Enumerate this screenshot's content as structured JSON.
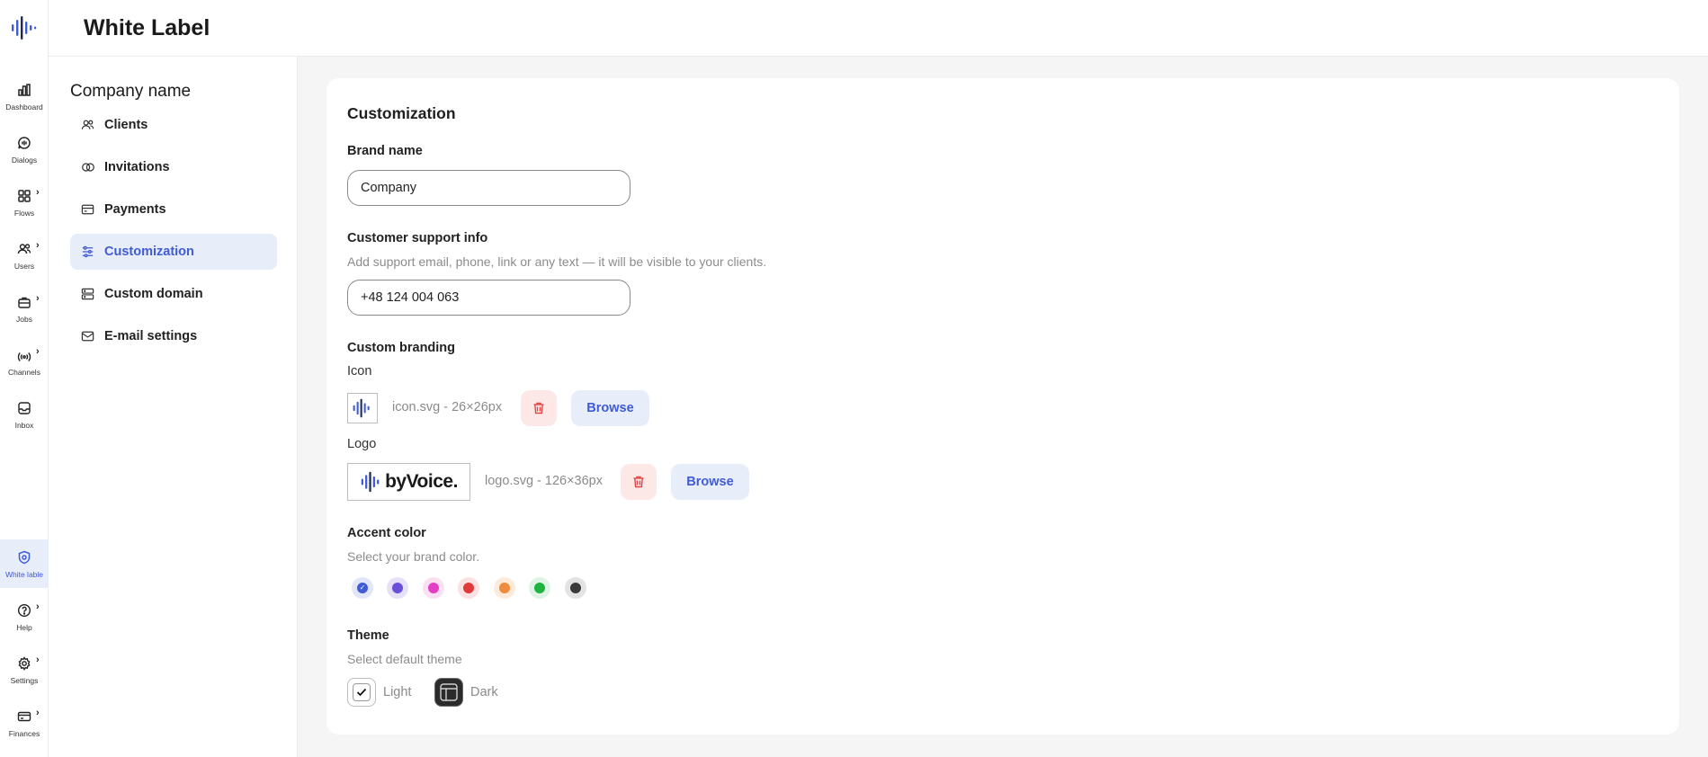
{
  "app": {
    "accent": "#3f5bd5"
  },
  "header": {
    "title": "White Label"
  },
  "rail": {
    "items": [
      {
        "label": "Dashboard",
        "icon": "bar-chart-icon",
        "has_submenu": false
      },
      {
        "label": "Dialogs",
        "icon": "chat-bubble-icon",
        "has_submenu": false
      },
      {
        "label": "Flows",
        "icon": "grid-icon",
        "has_submenu": true
      },
      {
        "label": "Users",
        "icon": "users-icon",
        "has_submenu": true
      },
      {
        "label": "Jobs",
        "icon": "briefcase-icon",
        "has_submenu": true
      },
      {
        "label": "Channels",
        "icon": "broadcast-icon",
        "has_submenu": true
      },
      {
        "label": "Inbox",
        "icon": "inbox-icon",
        "has_submenu": false
      },
      {
        "label": "White lable",
        "icon": "shield-icon",
        "has_submenu": false,
        "active": true
      },
      {
        "label": "Help",
        "icon": "help-icon",
        "has_submenu": true
      },
      {
        "label": "Settings",
        "icon": "gear-icon",
        "has_submenu": true
      },
      {
        "label": "Finances",
        "icon": "wallet-icon",
        "has_submenu": true
      }
    ]
  },
  "subnav": {
    "company": "Company name",
    "items": [
      {
        "label": "Clients",
        "icon": "users-icon"
      },
      {
        "label": "Invitations",
        "icon": "link-rings-icon"
      },
      {
        "label": "Payments",
        "icon": "credit-card-icon"
      },
      {
        "label": "Customization",
        "icon": "sliders-icon",
        "active": true
      },
      {
        "label": "Custom domain",
        "icon": "server-icon"
      },
      {
        "label": "E-mail settings",
        "icon": "mail-icon"
      }
    ]
  },
  "main": {
    "title": "Customization",
    "brand": {
      "label": "Brand name",
      "value": "Company"
    },
    "support": {
      "label": "Customer support info",
      "hint": "Add support email, phone, link or any text — it will be visible to your clients.",
      "value": "+48 124 004 063"
    },
    "branding": {
      "label": "Custom branding",
      "icon": {
        "label": "Icon",
        "file": "icon.svg - 26×26px",
        "browse": "Browse"
      },
      "logo": {
        "label": "Logo",
        "file": "logo.svg - 126×36px",
        "browse": "Browse",
        "logo_text": "byVoice."
      }
    },
    "accent": {
      "label": "Accent color",
      "hint": "Select your brand color.",
      "colors": [
        "#3f5bd5",
        "#6a4fd8",
        "#e23fc6",
        "#e03a3a",
        "#f08a3c",
        "#1fb340",
        "#3a3a3a"
      ],
      "rings": [
        "#e1e6f8",
        "#e6e1f8",
        "#fbe0f4",
        "#fbe1e1",
        "#fdeadb",
        "#dff4e4",
        "#e3e3e3"
      ],
      "selected": 0
    },
    "theme": {
      "label": "Theme",
      "hint": "Select default theme",
      "options": [
        {
          "label": "Light",
          "selected": true
        },
        {
          "label": "Dark",
          "selected": false
        }
      ]
    }
  }
}
